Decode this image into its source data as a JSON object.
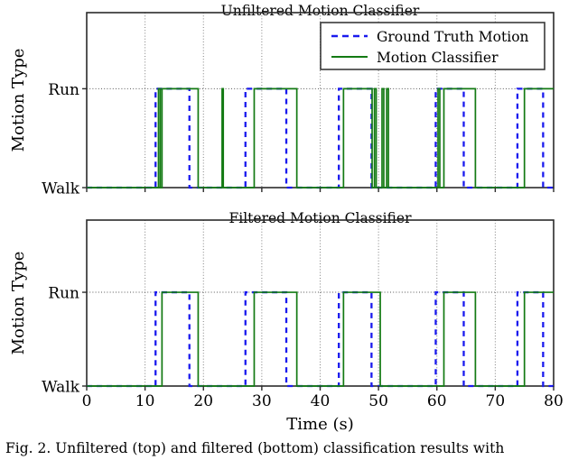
{
  "figure": {
    "caption": "Fig. 2. Unfiltered (top) and filtered (bottom) classification results with",
    "xlabel": "Time (s)",
    "ylabel": "Motion Type"
  },
  "legend": {
    "position": "upper-right-of-top-panel",
    "items": [
      {
        "label": "Ground Truth Motion",
        "style": "dashed",
        "color": "#1a1aee"
      },
      {
        "label": "Motion Classifier",
        "style": "solid",
        "color": "#137a13"
      }
    ]
  },
  "colors": {
    "ground_truth": "#1a1aee",
    "classifier": "#137a13",
    "axis": "#2b2b2b",
    "grid": "#808080",
    "background": "#ffffff"
  },
  "chart_data": [
    {
      "type": "line",
      "id": "unfiltered",
      "title": "Unfiltered Motion Classifier",
      "xlabel": "",
      "ylabel": "Motion Type",
      "xlim": [
        0,
        80
      ],
      "ylim": [
        0,
        1
      ],
      "xticks": [
        0,
        10,
        20,
        30,
        40,
        50,
        60,
        70,
        80
      ],
      "xticklabels": [
        "",
        "",
        "",
        "",
        "",
        "",
        "",
        "",
        ""
      ],
      "yticks": [
        0,
        1
      ],
      "yticklabels": [
        "Walk",
        "Run"
      ],
      "grid": true,
      "grid_axis": "both",
      "series": [
        {
          "name": "Ground Truth Motion",
          "style": "dashed",
          "color": "#1a1aee",
          "step": true,
          "points": [
            [
              0,
              0
            ],
            [
              11.8,
              0
            ],
            [
              11.8,
              1
            ],
            [
              17.6,
              1
            ],
            [
              17.6,
              0
            ],
            [
              27.2,
              0
            ],
            [
              27.2,
              1
            ],
            [
              34.2,
              1
            ],
            [
              34.2,
              0
            ],
            [
              43.2,
              0
            ],
            [
              43.2,
              1
            ],
            [
              48.8,
              1
            ],
            [
              48.8,
              0
            ],
            [
              59.8,
              0
            ],
            [
              59.8,
              1
            ],
            [
              64.6,
              1
            ],
            [
              64.6,
              0
            ],
            [
              73.8,
              0
            ],
            [
              73.8,
              1
            ],
            [
              78.2,
              1
            ],
            [
              78.2,
              0
            ],
            [
              80,
              0
            ]
          ]
        },
        {
          "name": "Motion Classifier",
          "style": "solid",
          "color": "#137a13",
          "step": true,
          "points": [
            [
              0,
              0
            ],
            [
              12.3,
              0
            ],
            [
              12.3,
              1
            ],
            [
              12.6,
              1
            ],
            [
              12.6,
              0
            ],
            [
              12.9,
              0
            ],
            [
              12.9,
              1
            ],
            [
              19.1,
              1
            ],
            [
              19.1,
              0
            ],
            [
              23.2,
              0
            ],
            [
              23.2,
              1
            ],
            [
              23.4,
              1
            ],
            [
              23.4,
              0
            ],
            [
              28.7,
              0
            ],
            [
              28.7,
              1
            ],
            [
              36.0,
              1
            ],
            [
              36.0,
              0
            ],
            [
              44.0,
              0
            ],
            [
              44.0,
              1
            ],
            [
              48.9,
              1
            ],
            [
              48.9,
              0
            ],
            [
              49.3,
              0
            ],
            [
              49.3,
              1
            ],
            [
              49.6,
              1
            ],
            [
              49.6,
              0
            ],
            [
              50.6,
              0
            ],
            [
              50.6,
              1
            ],
            [
              50.9,
              1
            ],
            [
              50.9,
              0
            ],
            [
              51.4,
              0
            ],
            [
              51.4,
              1
            ],
            [
              51.7,
              1
            ],
            [
              51.7,
              0
            ],
            [
              60.2,
              0
            ],
            [
              60.2,
              1
            ],
            [
              60.5,
              1
            ],
            [
              60.5,
              0
            ],
            [
              61.2,
              0
            ],
            [
              61.2,
              1
            ],
            [
              66.6,
              1
            ],
            [
              66.6,
              0
            ],
            [
              75.0,
              0
            ],
            [
              75.0,
              1
            ],
            [
              80.0,
              1
            ]
          ]
        }
      ]
    },
    {
      "type": "line",
      "id": "filtered",
      "title": "Filtered Motion Classifier",
      "xlabel": "Time (s)",
      "ylabel": "Motion Type",
      "xlim": [
        0,
        80
      ],
      "ylim": [
        0,
        1
      ],
      "xticks": [
        0,
        10,
        20,
        30,
        40,
        50,
        60,
        70,
        80
      ],
      "xticklabels": [
        "0",
        "10",
        "20",
        "30",
        "40",
        "50",
        "60",
        "70",
        "80"
      ],
      "yticks": [
        0,
        1
      ],
      "yticklabels": [
        "Walk",
        "Run"
      ],
      "grid": true,
      "grid_axis": "both",
      "series": [
        {
          "name": "Ground Truth Motion",
          "style": "dashed",
          "color": "#1a1aee",
          "step": true,
          "points": [
            [
              0,
              0
            ],
            [
              11.8,
              0
            ],
            [
              11.8,
              1
            ],
            [
              17.6,
              1
            ],
            [
              17.6,
              0
            ],
            [
              27.2,
              0
            ],
            [
              27.2,
              1
            ],
            [
              34.2,
              1
            ],
            [
              34.2,
              0
            ],
            [
              43.2,
              0
            ],
            [
              43.2,
              1
            ],
            [
              48.8,
              1
            ],
            [
              48.8,
              0
            ],
            [
              59.8,
              0
            ],
            [
              59.8,
              1
            ],
            [
              64.6,
              1
            ],
            [
              64.6,
              0
            ],
            [
              73.8,
              0
            ],
            [
              73.8,
              1
            ],
            [
              78.2,
              1
            ],
            [
              78.2,
              0
            ],
            [
              80,
              0
            ]
          ]
        },
        {
          "name": "Motion Classifier",
          "style": "solid",
          "color": "#137a13",
          "step": true,
          "points": [
            [
              0,
              0
            ],
            [
              12.9,
              0
            ],
            [
              12.9,
              1
            ],
            [
              19.1,
              1
            ],
            [
              19.1,
              0
            ],
            [
              28.7,
              0
            ],
            [
              28.7,
              1
            ],
            [
              36.0,
              1
            ],
            [
              36.0,
              0
            ],
            [
              44.0,
              0
            ],
            [
              44.0,
              1
            ],
            [
              50.3,
              1
            ],
            [
              50.3,
              0
            ],
            [
              61.2,
              0
            ],
            [
              61.2,
              1
            ],
            [
              66.6,
              1
            ],
            [
              66.6,
              0
            ],
            [
              75.0,
              0
            ],
            [
              75.0,
              1
            ],
            [
              80.0,
              1
            ]
          ]
        }
      ]
    }
  ]
}
